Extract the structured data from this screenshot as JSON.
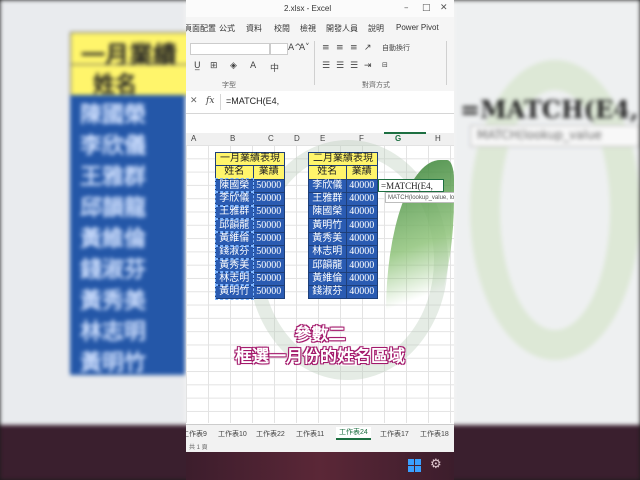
{
  "window": {
    "file_name": "2.xlsx  -  Excel",
    "minimize": "–",
    "maximize": "□",
    "close": "✕"
  },
  "menu": [
    "頁面配置",
    "公式",
    "資料",
    "校閱",
    "檢視",
    "開發人員",
    "說明",
    "Power Pivot"
  ],
  "ribbon": {
    "group_font": "字型",
    "group_align": "對齊方式",
    "wrap_text": "自動換行",
    "font_grow": "A^",
    "font_shrink": "A˅"
  },
  "formula_bar": {
    "cancel": "✕",
    "fx": "fx",
    "formula": "=MATCH(E4,"
  },
  "columns": [
    "A",
    "B",
    "C",
    "D",
    "E",
    "F",
    "G",
    "H"
  ],
  "selected_column": "G",
  "table_jan": {
    "title": "一月業績表現",
    "headers": [
      "姓名",
      "業績"
    ],
    "rows": [
      [
        "陳國榮",
        "50000"
      ],
      [
        "李欣儀",
        "50000"
      ],
      [
        "王雅群",
        "50000"
      ],
      [
        "邱韻龍",
        "50000"
      ],
      [
        "黃維倫",
        "50000"
      ],
      [
        "錢淑芬",
        "50000"
      ],
      [
        "黃秀美",
        "50000"
      ],
      [
        "林志明",
        "50000"
      ],
      [
        "黃明竹",
        "50000"
      ]
    ]
  },
  "table_feb": {
    "title": "二月業績表現",
    "headers": [
      "姓名",
      "業績"
    ],
    "rows": [
      [
        "李欣儀",
        "40000"
      ],
      [
        "王雅群",
        "40000"
      ],
      [
        "陳國榮",
        "40000"
      ],
      [
        "黃明竹",
        "40000"
      ],
      [
        "黃秀美",
        "40000"
      ],
      [
        "林志明",
        "40000"
      ],
      [
        "邱韻龍",
        "40000"
      ],
      [
        "黃維倫",
        "40000"
      ],
      [
        "錢淑芬",
        "40000"
      ]
    ]
  },
  "active_cell": {
    "text": "=MATCH(E4,"
  },
  "tooltip": "MATCH(lookup_value, lookup_array, [match_type])",
  "caption": {
    "line1": "參數二",
    "line2": "框選一月份的姓名區域"
  },
  "sheet_tabs": [
    "工作表9",
    "工作表10",
    "工作表22",
    "工作表11",
    "工作表24",
    "工作表17",
    "工作表18"
  ],
  "active_sheet": "工作表24",
  "status": "共 1 頁",
  "background_zoom": {
    "title": "一月業績",
    "header": "姓名",
    "names": [
      "陳國榮",
      "李欣儀",
      "王雅群",
      "邱韻龍",
      "黃維倫",
      "錢淑芬",
      "黃秀美",
      "林志明",
      "黃明竹"
    ],
    "formula": "=MATCH(E4,",
    "tooltip": "MATCH(lookup_value"
  },
  "colors": {
    "excel_green": "#1d6f41",
    "title_yellow": "#fff56b",
    "cell_blue": "#2a5bb2",
    "caption_outline": "#a3186b"
  }
}
